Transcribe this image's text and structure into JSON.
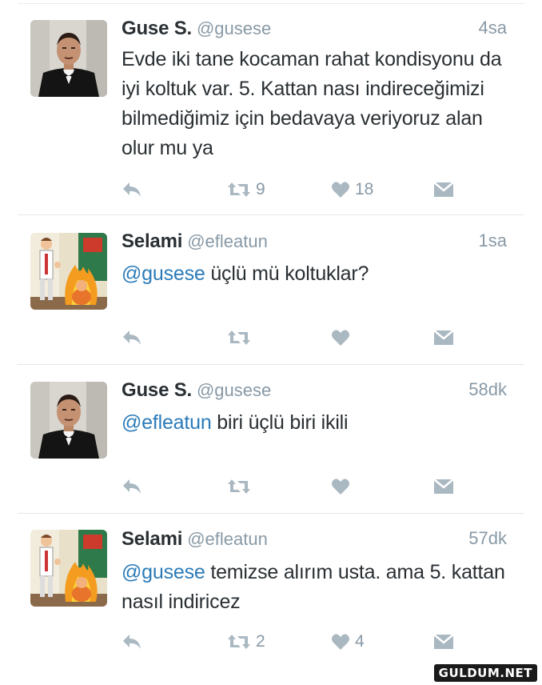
{
  "tweets": [
    {
      "name": "Guse S.",
      "handle": "@gusese",
      "time": "4sa",
      "mention": "",
      "body": "Evde iki tane kocaman rahat kondisyonu da iyi koltuk var. 5. Kattan nası indireceğimizi bilmediğimiz için bedavaya veriyoruz alan olur mu ya",
      "retweets": "9",
      "likes": "18",
      "avatar": "man-in-tuxedo"
    },
    {
      "name": "Selami",
      "handle": "@efleatun",
      "time": "1sa",
      "mention": "@gusese",
      "body": " üçlü mü koltuklar?",
      "retweets": "",
      "likes": "",
      "avatar": "cartoon-monk-fire"
    },
    {
      "name": "Guse S.",
      "handle": "@gusese",
      "time": "58dk",
      "mention": "@efleatun",
      "body": " biri üçlü biri ikili",
      "retweets": "",
      "likes": "",
      "avatar": "man-in-tuxedo"
    },
    {
      "name": "Selami",
      "handle": "@efleatun",
      "time": "57dk",
      "mention": "@gusese",
      "body": " temizse alırım usta. ama 5. kattan nasıl indiricez",
      "retweets": "2",
      "likes": "4",
      "avatar": "cartoon-monk-fire"
    }
  ],
  "watermark": "GULDUM.NET",
  "colors": {
    "mention": "#2b7bb9",
    "muted": "#8899a6",
    "icon": "#aab8c2",
    "text": "#292f33"
  }
}
